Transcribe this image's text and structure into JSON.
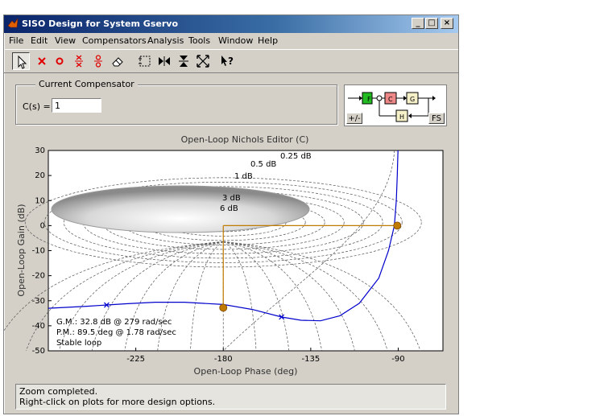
{
  "window": {
    "title": "SISO Design for System Gservo",
    "minimize_label": "_",
    "maximize_label": "□",
    "close_label": "×"
  },
  "menu": {
    "items": [
      "File",
      "Edit",
      "View",
      "Compensators",
      "Analysis",
      "Tools",
      "Window",
      "Help"
    ]
  },
  "toolbar": {
    "tools": [
      "select-pointer",
      "add-real-pole",
      "add-real-zero",
      "add-complex-pole",
      "add-complex-zero",
      "erase",
      "zoom-xy",
      "zoom-x",
      "zoom-y",
      "zoom-fit",
      "whats-this-help"
    ]
  },
  "compensator": {
    "group_title": "Current Compensator",
    "cs_label": "C(s) =",
    "cs_value": "1"
  },
  "block_diagram": {
    "blocks": [
      "F",
      "C",
      "G",
      "H"
    ],
    "sign_button": "+/-",
    "fs_button": "FS",
    "colors": {
      "F": "#22bb22",
      "C": "#ee8888",
      "G": "#f5f0c8",
      "H": "#f5f0c8"
    }
  },
  "plot": {
    "title": "Open-Loop Nichols Editor (C)",
    "xlabel": "Open-Loop Phase (deg)",
    "ylabel": "Open-Loop Gain (dB)",
    "x_ticks": [
      "-225",
      "-180",
      "-135",
      "-90"
    ],
    "y_ticks": [
      "30",
      "20",
      "10",
      "0",
      "-10",
      "-20",
      "-30",
      "-40",
      "-50"
    ],
    "grid_labels": [
      "0.25 dB",
      "0.5 dB",
      "1 dB",
      "3 dB",
      "6 dB"
    ],
    "margins": [
      "G.M.: 32.8 dB @ 279 rad/sec",
      "P.M.: 89.5 deg @ 1.78 rad/sec",
      "Stable loop"
    ],
    "curve_color": "#0000cc",
    "margin_color": "#c07a00"
  },
  "chart_data": {
    "type": "line",
    "title": "Open-Loop Nichols Editor (C)",
    "xlabel": "Open-Loop Phase (deg)",
    "ylabel": "Open-Loop Gain (dB)",
    "xlim": [
      -270,
      -67
    ],
    "ylim": [
      -50,
      30
    ],
    "grid": true,
    "series": [
      {
        "x": [
          -270,
          -250,
          -230,
          -215,
          -200,
          -180,
          -165,
          -150,
          -140,
          -130,
          -120,
          -110,
          -100,
          -95,
          -92,
          -91,
          -90.5,
          -90.2,
          -90.1
        ],
        "y": [
          -33,
          -32.2,
          -31.2,
          -30.6,
          -30.6,
          -31.5,
          -33.5,
          -36.5,
          -37.8,
          -38,
          -36,
          -31,
          -21,
          -10,
          0,
          10,
          20,
          28,
          30
        ]
      }
    ],
    "markers": [
      {
        "x": -180,
        "y": -32.8,
        "label": "gain margin"
      },
      {
        "x": -90.5,
        "y": 0,
        "label": "phase margin"
      }
    ]
  },
  "status": {
    "line1": "Zoom completed.",
    "line2": "Right-click on plots for more design options."
  }
}
